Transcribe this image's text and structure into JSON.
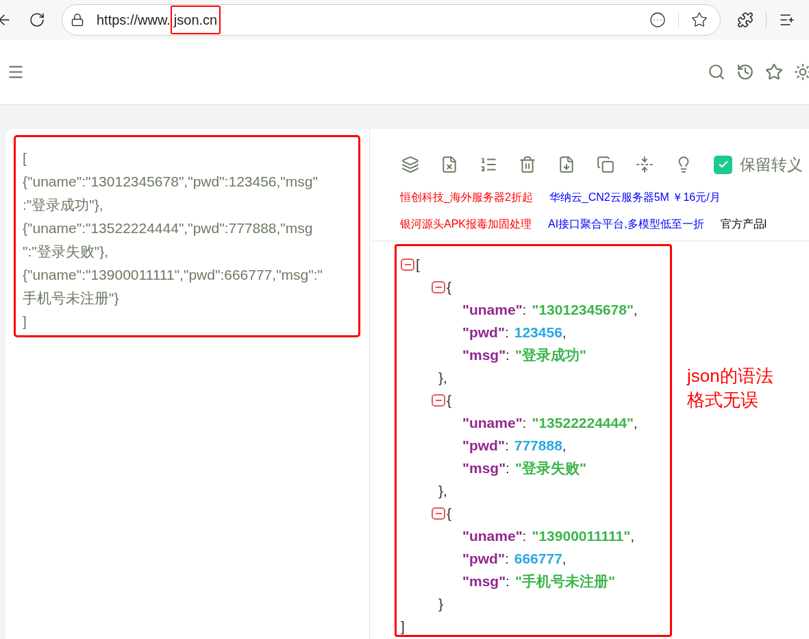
{
  "browser": {
    "url_prefix": "https://www.",
    "url_highlight": "json.cn"
  },
  "input": {
    "lines": [
      "[",
      "{\"uname\":\"13012345678\",\"pwd\":123456,\"msg\"",
      ":\"登录成功\"},",
      "{\"uname\":\"13522224444\",\"pwd\":777888,\"msg",
      "\":\"登录失败\"},",
      "{\"uname\":\"13900011111\",\"pwd\":666777,\"msg\":\"",
      "手机号未注册\"}",
      "]"
    ]
  },
  "toolbar": {
    "keep_escape": {
      "label": "保留转义",
      "checked": true
    }
  },
  "ads": [
    [
      {
        "text": "恒创科技_海外服务器2折起",
        "color": "#ff0000"
      },
      {
        "text": "华纳云_CN2云服务器5M ￥16元/月",
        "color": "#0000ff"
      }
    ],
    [
      {
        "text": "银河源头APK报毒加固处理",
        "color": "#ff0000"
      },
      {
        "text": "AI接口聚合平台,多模型低至一折",
        "color": "#0000ff"
      },
      {
        "text": "官方产品l",
        "color": "#000000"
      }
    ]
  ],
  "output": {
    "open": "[",
    "close": "]",
    "expanded": true,
    "items": [
      {
        "open": "{",
        "close": "},",
        "expanded": true,
        "fields": [
          {
            "key": "\"uname\"",
            "colon": ":",
            "value": "\"13012345678\"",
            "kind": "string",
            "comma": ","
          },
          {
            "key": "\"pwd\"",
            "colon": ":",
            "value": "123456",
            "kind": "number",
            "comma": ","
          },
          {
            "key": "\"msg\"",
            "colon": ":",
            "value": "\"登录成功\"",
            "kind": "string"
          }
        ]
      },
      {
        "open": "{",
        "close": "},",
        "expanded": true,
        "fields": [
          {
            "key": "\"uname\"",
            "colon": ":",
            "value": "\"13522224444\"",
            "kind": "string",
            "comma": ","
          },
          {
            "key": "\"pwd\"",
            "colon": ":",
            "value": "777888",
            "kind": "number",
            "comma": ","
          },
          {
            "key": "\"msg\"",
            "colon": ":",
            "value": "\"登录失败\"",
            "kind": "string"
          }
        ]
      },
      {
        "open": "{",
        "close": "}",
        "expanded": true,
        "fields": [
          {
            "key": "\"uname\"",
            "colon": ":",
            "value": "\"13900011111\"",
            "kind": "string",
            "comma": ","
          },
          {
            "key": "\"pwd\"",
            "colon": ":",
            "value": "666777",
            "kind": "number",
            "comma": ","
          },
          {
            "key": "\"msg\"",
            "colon": ":",
            "value": "\"手机号未注册\"",
            "kind": "string"
          }
        ]
      }
    ]
  },
  "annotation": {
    "lines": [
      "json的语法",
      "格式无误"
    ]
  }
}
